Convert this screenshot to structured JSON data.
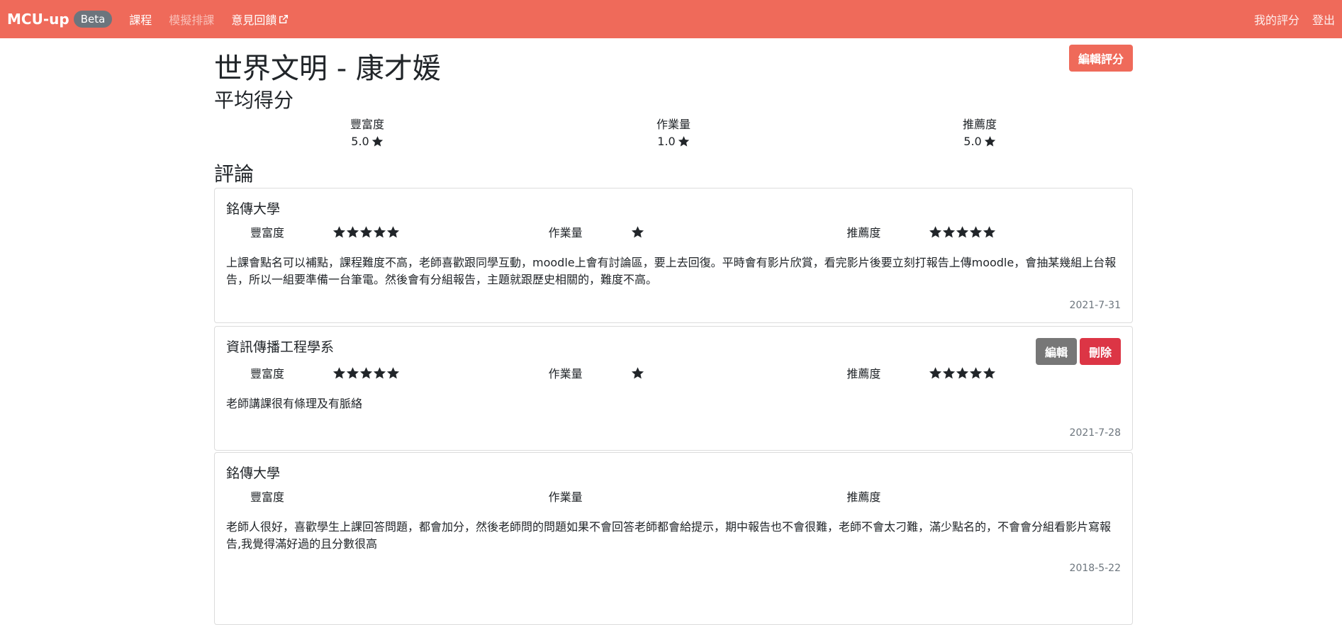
{
  "nav": {
    "brand": "MCU-up",
    "badge": "Beta",
    "links": [
      "課程",
      "模擬排課",
      "意見回饋"
    ],
    "right_links": [
      "我的評分",
      "登出"
    ]
  },
  "course": {
    "title": "世界文明 - 康才媛",
    "edit_rating_label": "編輯評分"
  },
  "average": {
    "title": "平均得分",
    "items": [
      {
        "label": "豐富度",
        "value": "5.0"
      },
      {
        "label": "作業量",
        "value": "1.0"
      },
      {
        "label": "推薦度",
        "value": "5.0"
      }
    ]
  },
  "comments": {
    "title": "評論",
    "labels": {
      "richness": "豐富度",
      "workload": "作業量",
      "recommend": "推薦度"
    },
    "items": [
      {
        "department": "銘傳大學",
        "richness_stars": 5,
        "workload_stars": 1,
        "recommend_stars": 5,
        "text": "上課會點名可以補點，課程難度不高，老師喜歡跟同學互動，moodle上會有討論區，要上去回復。平時會有影片欣賞，看完影片後要立刻打報告上傳moodle，會抽某幾組上台報告，所以一組要準備一台筆電。然後會有分組報告，主題就跟歷史相關的，難度不高。",
        "date": "2021-7-31"
      },
      {
        "department": "資訊傳播工程學系",
        "richness_stars": 5,
        "workload_stars": 1,
        "recommend_stars": 5,
        "text": "老師講課很有條理及有脈絡",
        "date": "2021-7-28",
        "edit_label": "編輯",
        "delete_label": "刪除"
      },
      {
        "department": "銘傳大學",
        "richness_stars": 0,
        "workload_stars": 0,
        "recommend_stars": 0,
        "text": "老師人很好，喜歡學生上課回答問題，都會加分，然後老師問的問題如果不會回答老師都會給提示，期中報告也不會很難，老師不會太刁難，滿少點名的，不會會分組看影片寫報告,我覺得滿好過的且分數很高",
        "date": "2018-5-22"
      }
    ]
  }
}
